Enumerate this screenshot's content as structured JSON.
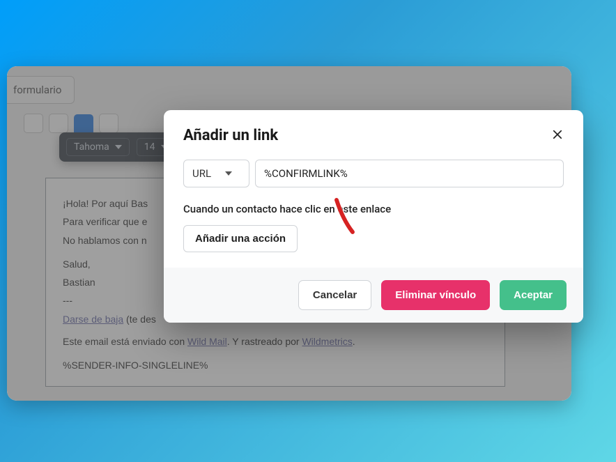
{
  "tab": {
    "label": "formulario"
  },
  "fontbar": {
    "family": "Tahoma",
    "size": "14"
  },
  "editor": {
    "line1": "¡Hola! Por aquí Bas",
    "line2": "Para verificar que e",
    "line3": "No hablamos con n",
    "line4": "Salud,",
    "line5": "Bastian",
    "sep": "---",
    "unsub_link": "Darse de baja",
    "unsub_rest": " (te des",
    "sent1": "Este email está enviado con ",
    "sent_link1": "Wild Mail",
    "sent2": ". Y rastreado por ",
    "sent_link2": "Wildmetrics",
    "sent3": ".",
    "sender": "%SENDER-INFO-SINGLELINE%"
  },
  "modal": {
    "title": "Añadir un link",
    "type_label": "URL",
    "url_value": "%CONFIRMLINK%",
    "hint": "Cuando un contacto hace clic en este enlace",
    "add_action": "Añadir una acción",
    "cancel": "Cancelar",
    "remove": "Eliminar vínculo",
    "accept": "Aceptar"
  }
}
